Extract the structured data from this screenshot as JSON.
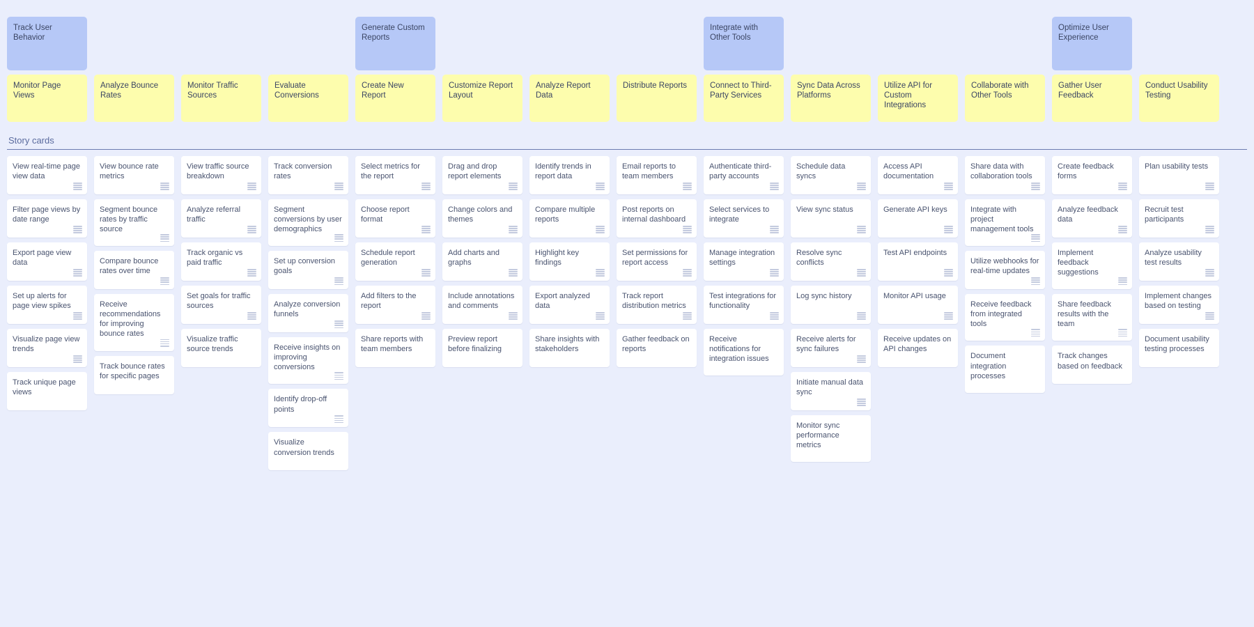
{
  "board": {
    "section_title": "Story cards",
    "colors": {
      "background": "#eaeefc",
      "epic_card": "#b6c8f7",
      "activity_card": "#fdfdad",
      "story_card": "#ffffff",
      "text": "#3b4563",
      "divider": "#6c7bb0"
    }
  },
  "columns": [
    {
      "epic": "Track User Behavior",
      "activity": "Monitor Page Views",
      "stories": [
        "View real-time page view data",
        "Filter page views by date range",
        "Export page view data",
        "Set up alerts for page view spikes",
        "Visualize page view trends",
        "Track unique page views"
      ]
    },
    {
      "epic": "",
      "activity": "Analyze Bounce Rates",
      "stories": [
        "View bounce rate metrics",
        "Segment bounce rates by traffic source",
        "Compare bounce rates over time",
        "Receive recommendations for improving bounce rates",
        "Track bounce rates for specific pages"
      ]
    },
    {
      "epic": "",
      "activity": "Monitor Traffic Sources",
      "stories": [
        "View traffic source breakdown",
        "Analyze referral traffic",
        "Track organic vs paid traffic",
        "Set goals for traffic sources",
        "Visualize traffic source trends"
      ]
    },
    {
      "epic": "",
      "activity": "Evaluate Conversions",
      "stories": [
        "Track conversion rates",
        "Segment conversions by user demographics",
        "Set up conversion goals",
        "Analyze conversion funnels",
        "Receive insights on improving conversions",
        "Identify drop-off points",
        "Visualize conversion trends"
      ]
    },
    {
      "epic": "Generate Custom Reports",
      "activity": "Create New Report",
      "stories": [
        "Select metrics for the report",
        "Choose report format",
        "Schedule report generation",
        "Add filters to the report",
        "Share reports with team members"
      ]
    },
    {
      "epic": "",
      "activity": "Customize Report Layout",
      "stories": [
        "Drag and drop report elements",
        "Change colors and themes",
        "Add charts and graphs",
        "Include annotations and comments",
        "Preview report before finalizing"
      ]
    },
    {
      "epic": "",
      "activity": "Analyze Report Data",
      "stories": [
        "Identify trends in report data",
        "Compare multiple reports",
        "Highlight key findings",
        "Export analyzed data",
        "Share insights with stakeholders"
      ]
    },
    {
      "epic": "",
      "activity": "Distribute Reports",
      "stories": [
        "Email reports to team members",
        "Post reports on internal dashboard",
        "Set permissions for report access",
        "Track report distribution metrics",
        "Gather feedback on reports"
      ]
    },
    {
      "epic": "Integrate with Other Tools",
      "activity": "Connect to Third-Party Services",
      "stories": [
        "Authenticate third-party accounts",
        "Select services to integrate",
        "Manage integration settings",
        "Test integrations for functionality",
        "Receive notifications for integration issues"
      ]
    },
    {
      "epic": "",
      "activity": "Sync Data Across Platforms",
      "stories": [
        "Schedule data syncs",
        "View sync status",
        "Resolve sync conflicts",
        "Log sync history",
        "Receive alerts for sync failures",
        "Initiate manual data sync",
        "Monitor sync performance metrics"
      ]
    },
    {
      "epic": "",
      "activity": "Utilize API for Custom Integrations",
      "stories": [
        "Access API documentation",
        "Generate API keys",
        "Test API endpoints",
        "Monitor API usage",
        "Receive updates on API changes"
      ]
    },
    {
      "epic": "",
      "activity": "Collaborate with Other Tools",
      "stories": [
        "Share data with collaboration tools",
        "Integrate with project management tools",
        "Utilize webhooks for real-time updates",
        "Receive feedback from integrated tools",
        "Document integration processes"
      ]
    },
    {
      "epic": "Optimize User Experience",
      "activity": "Gather User Feedback",
      "stories": [
        "Create feedback forms",
        "Analyze feedback data",
        "Implement feedback suggestions",
        "Share feedback results with the team",
        "Track changes based on feedback"
      ]
    },
    {
      "epic": "",
      "activity": "Conduct Usability Testing",
      "stories": [
        "Plan usability tests",
        "Recruit test participants",
        "Analyze usability test results",
        "Implement changes based on testing",
        "Document usability testing processes"
      ]
    }
  ]
}
